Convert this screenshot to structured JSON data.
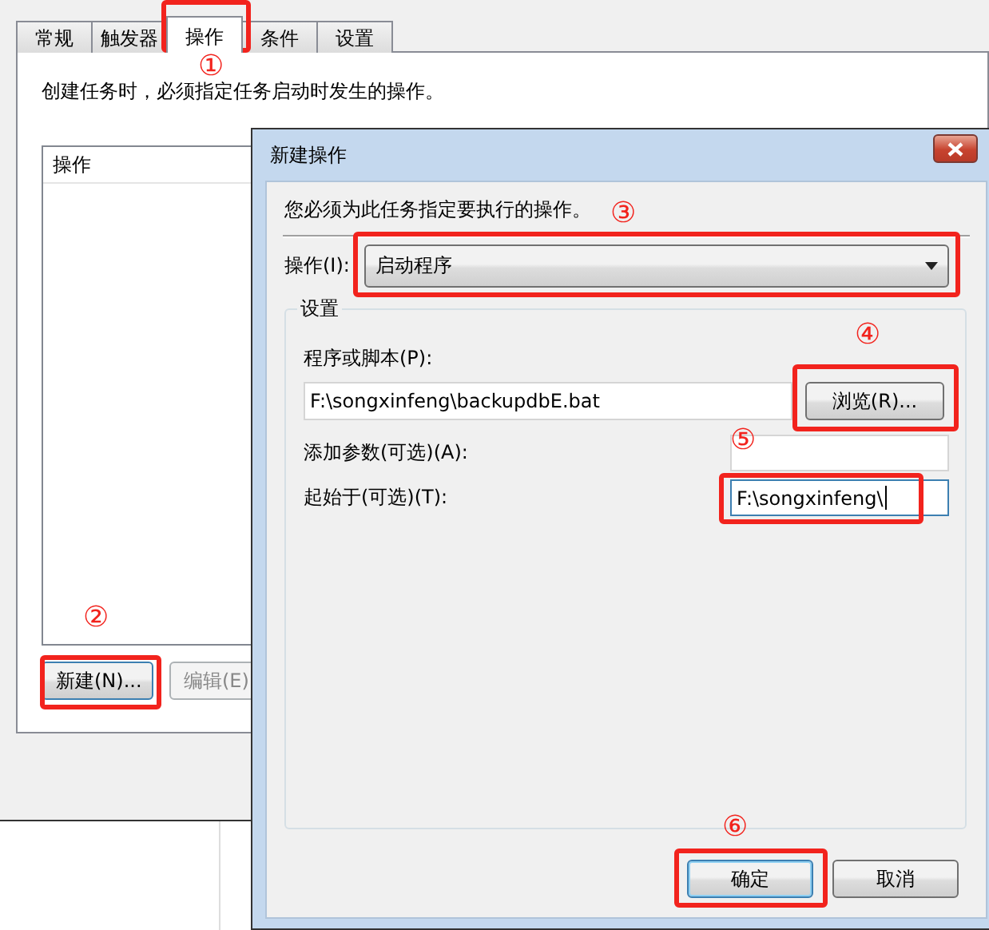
{
  "background_window": {
    "tabs": [
      {
        "label": "常规",
        "selected": false
      },
      {
        "label": "触发器",
        "selected": false
      },
      {
        "label": "操作",
        "selected": true
      },
      {
        "label": "条件",
        "selected": false
      },
      {
        "label": "设置",
        "selected": false
      }
    ],
    "description": "创建任务时，必须指定任务启动时发生的操作。",
    "list": {
      "columns": [
        "操作"
      ]
    },
    "buttons": [
      {
        "label": "新建(N)...",
        "disabled": false
      },
      {
        "label": "编辑(E)",
        "disabled": true
      }
    ]
  },
  "dialog": {
    "title": "新建操作",
    "instruction": "您必须为此任务指定要执行的操作。",
    "action": {
      "label": "操作(I):",
      "value": "启动程序"
    },
    "group": {
      "title": "设置",
      "program": {
        "label": "程序或脚本(P):",
        "value": "F:\\songxinfeng\\backupdbE.bat"
      },
      "browse_button": "浏览(R)...",
      "arguments": {
        "label": "添加参数(可选)(A):"
      },
      "start_in": {
        "label": "起始于(可选)(T):",
        "value": "F:\\songxinfeng\\",
        "focused": true
      }
    },
    "buttons": [
      {
        "label": "确定",
        "default": true
      },
      {
        "label": "取消",
        "default": false
      }
    ]
  },
  "annotations": [
    {
      "number": "①"
    },
    {
      "number": "②"
    },
    {
      "number": "③"
    },
    {
      "number": "④"
    },
    {
      "number": "⑤"
    },
    {
      "number": "⑥"
    }
  ]
}
